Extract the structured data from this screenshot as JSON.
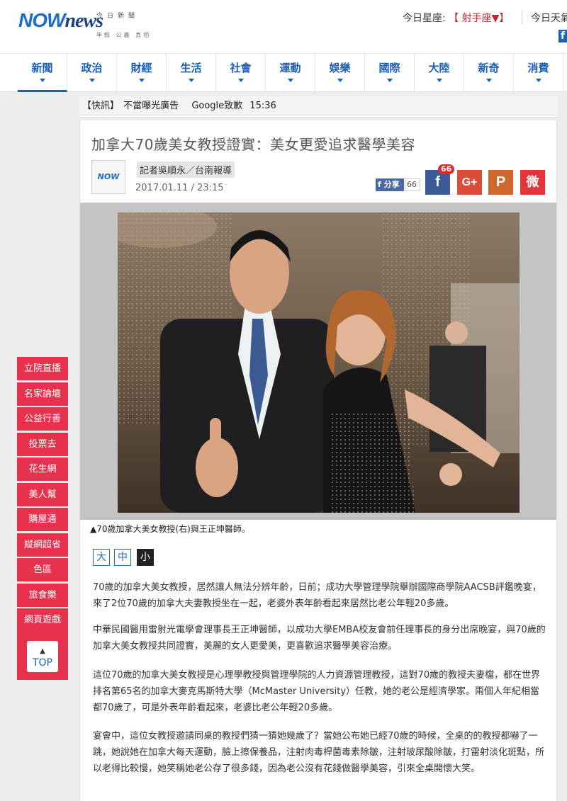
{
  "logo": {
    "brand_now": "NOW",
    "brand_news": "news",
    "sub_top": "今日新聞",
    "sub_bottom": "年輕 公義 真相"
  },
  "header": {
    "horoscope_label": "今日星座:",
    "horoscope_sign": "【 射手座▼】",
    "weather_label": "今日天氣"
  },
  "nav": {
    "items": [
      "新聞",
      "政治",
      "財經",
      "生活",
      "社會",
      "運動",
      "娛樂",
      "國際",
      "大陸",
      "新奇",
      "消費"
    ],
    "active": "新聞"
  },
  "flash": {
    "label": "【快訊】",
    "items": [
      "不當曝光廣告",
      "Google致歉",
      "15:36"
    ]
  },
  "article": {
    "title": "加拿大70歲美女教授證實：美女更愛追求醫學美容",
    "author_logo": "NOW news",
    "reporter": "記者吳順永／台南報導",
    "date": "2017.01.11 / 23:15",
    "fb_share_label": "分享",
    "fb_share_count": "66",
    "share_badge": "66",
    "share_icons": [
      "facebook-icon",
      "google-plus-icon",
      "plurk-icon",
      "weibo-icon"
    ],
    "share_glyphs": {
      "facebook": "f",
      "gplus": "G+",
      "plurk": "P",
      "weibo": "微"
    },
    "caption": "▲70歲加拿大美女教授(右)與王正坤醫師。",
    "font_sizes": [
      "大",
      "中",
      "小"
    ],
    "paragraphs": [
      "70歲的加拿大美女教授，居然讓人無法分辨年齡，日前；成功大學管理學院舉辦國際商學院AACSB評鑑晚宴，來了2位70歲的加拿大夫妻教授坐在一起，老婆外表年齡看起來居然比老公年輕20多歲。",
      "中華民國醫用雷射光電學會理事長王正坤醫師，以成功大學EMBA校友會前任理事長的身分出席晚宴，與70歲的加拿大美女教授共同證實，美麗的女人更愛美，更喜歡追求醫學美容治療。",
      "這位70歲的加拿大美女教授是心理學教授與管理學院的人力資源管理教授，這對70歲的教授夫妻檔，都在世界排名第65名的加拿大麥克馬斯特大學（McMaster University）任教，她的老公是經濟學家。兩個人年紀相當都70歲了，可是外表年齡看起來，老婆比老公年輕20多歲。",
      "宴會中，這位女教授邀請同桌的教授們猜一猜她幾歲了？當她公布她已經70歲的時候，全桌的的教授都嚇了一跳，她說她在加拿大每天運動，臉上擦保養品，注射肉毒桿菌毒素除皺，注射玻尿酸除皺，打雷射淡化斑點，所以老得比較慢，她笑稱她老公存了很多錢，因為老公沒有花錢做醫學美容，引來全桌開懷大笑。"
    ]
  },
  "side_menu": {
    "items": [
      "立院直播",
      "名家論壇",
      "公益行善",
      "投票去",
      "花生網",
      "美人幫",
      "購屋通",
      "縱網超省",
      "色區",
      "旅食樂",
      "網頁遊戲"
    ],
    "top_label": "TOP",
    "top_arrow": "▲"
  },
  "colors": {
    "brand_blue": "#1d5fb6",
    "side_red": "#e8314c",
    "page_bg": "#ededed"
  }
}
